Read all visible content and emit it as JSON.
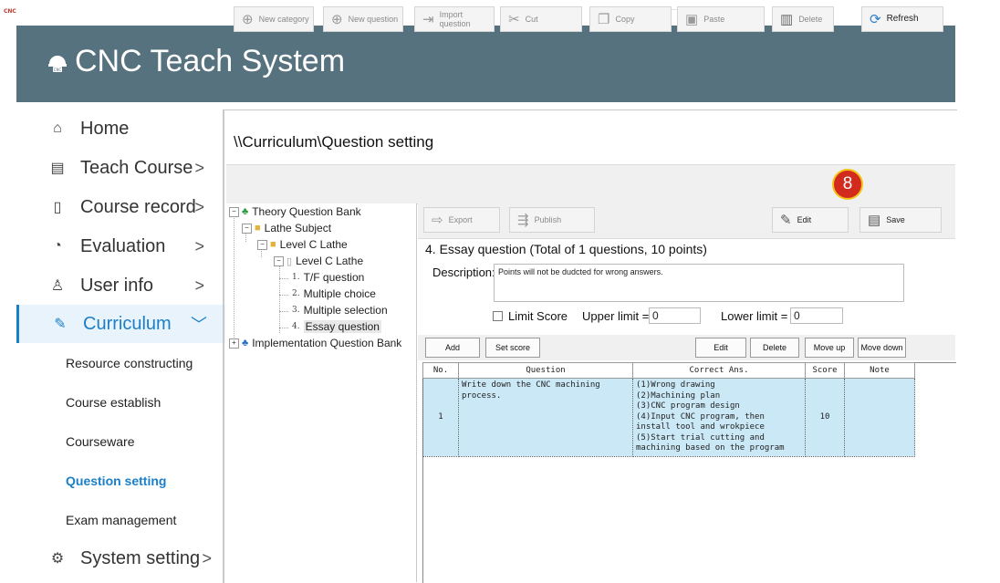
{
  "app": {
    "small_logo_text": "CNC",
    "title": "CNC Teach System"
  },
  "nav": {
    "items": [
      {
        "label": "Home",
        "icon": "home-icon",
        "glyph": "⌂",
        "chevron": ""
      },
      {
        "label": "Teach Course",
        "icon": "book-icon",
        "glyph": "▤",
        "chevron": ">"
      },
      {
        "label": "Course record",
        "icon": "document-icon",
        "glyph": "▯",
        "chevron": ">"
      },
      {
        "label": "Evaluation",
        "icon": "pie-chart-icon",
        "glyph": "◔",
        "chevron": ">"
      },
      {
        "label": "User info",
        "icon": "user-icon",
        "glyph": "♙",
        "chevron": ">"
      },
      {
        "label": "Curriculum",
        "icon": "pencil-icon",
        "glyph": "✎",
        "chevron": "﹀"
      }
    ],
    "sub_items": [
      {
        "label": "Resource constructing"
      },
      {
        "label": "Course establish"
      },
      {
        "label": "Courseware"
      },
      {
        "label": "Question setting"
      },
      {
        "label": "Exam management"
      }
    ],
    "system": {
      "label": "System setting",
      "icon": "gear-icon",
      "glyph": "⚙",
      "chevron": ">"
    }
  },
  "breadcrumb": "\\\\Curriculum\\Question setting",
  "toolbar": {
    "new_category": "New category",
    "new_question": "New question",
    "import_question": "Import question",
    "cut": "Cut",
    "copy": "Copy",
    "paste": "Paste",
    "delete": "Delete",
    "refresh": "Refresh",
    "export": "Export",
    "publish": "Publish",
    "edit": "Edit",
    "save": "Save"
  },
  "badge": "8",
  "tree": {
    "theory_bank": "Theory Question Bank",
    "lathe_subject": "Lathe Subject",
    "level_c_lathe_folder": "Level C Lathe",
    "level_c_lathe_file": "Level C Lathe",
    "q1": {
      "num": "1.",
      "label": "T/F question"
    },
    "q2": {
      "num": "2.",
      "label": "Multiple choice"
    },
    "q3": {
      "num": "3.",
      "label": "Multiple selection"
    },
    "q4": {
      "num": "4.",
      "label": "Essay question"
    },
    "implementation_bank": "Implementation Question Bank"
  },
  "section": {
    "title": "4. Essay question (Total of 1 questions, 10 points)",
    "description_label": "Description:",
    "description_value": "Points will not be dudcted for wrong answers.",
    "limit_score_label": "Limit Score",
    "upper_limit_label": "Upper limit =",
    "upper_limit_value": "0",
    "lower_limit_label": "Lower limit =",
    "lower_limit_value": "0"
  },
  "question_toolbar": {
    "add": "Add",
    "set_score": "Set score",
    "edit": "Edit",
    "delete": "Delete",
    "move_up": "Move up",
    "move_down": "Move down"
  },
  "table": {
    "headers": [
      "No.",
      "Question",
      "Correct Ans.",
      "Score",
      "Note"
    ],
    "rows": [
      {
        "no": "1",
        "question": "Write down the CNC machining process.",
        "answer": "(1)Wrong drawing\n(2)Machining plan\n(3)CNC program design\n(4)Input CNC program, then install tool and wrokpiece\n(5)Start trial cutting and machining based on the program",
        "score": "10",
        "note": ""
      }
    ]
  },
  "colors": {
    "header_bg": "#56727f",
    "accent": "#1a7fc8",
    "selected_row": "#cbe8f6",
    "badge": "#d32a1e"
  }
}
